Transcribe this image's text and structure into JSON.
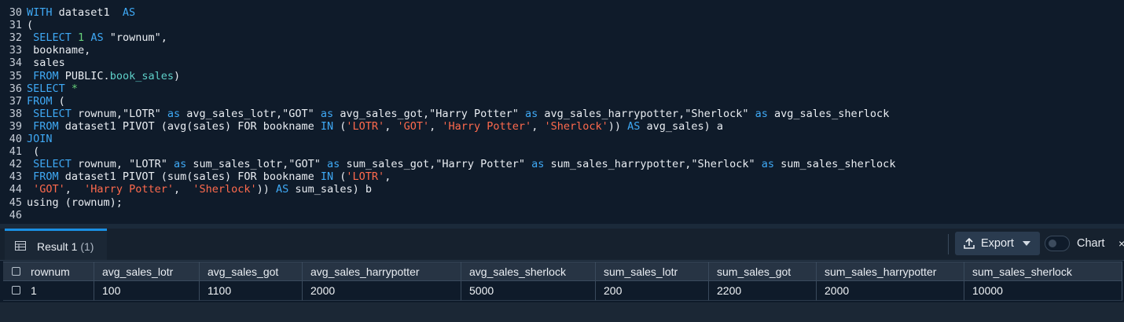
{
  "editor": {
    "lines": [
      {
        "n": "30",
        "t": [
          [
            "kw",
            "WITH"
          ],
          [
            "",
            "dataset1 "
          ],
          [
            "kw",
            "AS"
          ]
        ]
      },
      {
        "n": "31",
        "t": [
          [
            "",
            "("
          ]
        ]
      },
      {
        "n": "32",
        "t": [
          [
            "",
            ""
          ],
          [
            "kw",
            "SELECT"
          ],
          [
            "",
            ""
          ],
          [
            "num",
            "1"
          ],
          [
            "",
            ""
          ],
          [
            "kw",
            "AS"
          ],
          [
            "",
            "\"rownum\","
          ]
        ]
      },
      {
        "n": "33",
        "t": [
          [
            "",
            "bookname,"
          ]
        ]
      },
      {
        "n": "34",
        "t": [
          [
            "",
            "sales"
          ]
        ]
      },
      {
        "n": "35",
        "t": [
          [
            "kw",
            "FROM"
          ],
          [
            "",
            "PUBLIC."
          ],
          [
            "ident",
            "book_sales"
          ],
          [
            "",
            ")"
          ]
        ]
      },
      {
        "n": "36",
        "t": [
          [
            "kw",
            "SELECT"
          ],
          [
            "num",
            "*"
          ]
        ]
      },
      {
        "n": "37",
        "t": [
          [
            "kw",
            "FROM"
          ],
          [
            "",
            "("
          ]
        ]
      },
      {
        "n": "38",
        "t": [
          [
            "kw",
            "SELECT"
          ],
          [
            "",
            "rownum,\"LOTR\""
          ],
          [
            "kw",
            "as"
          ],
          [
            "",
            "avg_sales_lotr,\"GOT\""
          ],
          [
            "kw",
            "as"
          ],
          [
            "",
            "avg_sales_got,\"Harry Potter\""
          ],
          [
            "kw",
            "as"
          ],
          [
            "",
            "avg_sales_harrypotter,\"Sherlock\""
          ],
          [
            "kw",
            "as"
          ],
          [
            "",
            "avg_sales_sherlock"
          ]
        ]
      },
      {
        "n": "39",
        "t": [
          [
            "kw",
            "FROM"
          ],
          [
            "",
            "dataset1 PIVOT (avg(sales) FOR bookname"
          ],
          [
            "kw",
            "IN"
          ],
          [
            "",
            "("
          ],
          [
            "str",
            "'LOTR'"
          ],
          [
            "",
            ","
          ],
          [
            "str",
            "'GOT'"
          ],
          [
            "",
            ","
          ],
          [
            "str",
            "'Harry Potter'"
          ],
          [
            "",
            ","
          ],
          [
            "str",
            "'Sherlock'"
          ],
          [
            "",
            "))"
          ],
          [
            "kw",
            "AS"
          ],
          [
            "",
            "avg_sales) a"
          ]
        ]
      },
      {
        "n": "40",
        "t": [
          [
            "kw",
            "JOIN"
          ]
        ]
      },
      {
        "n": "41",
        "t": [
          [
            "",
            "("
          ]
        ]
      },
      {
        "n": "42",
        "t": [
          [
            "kw",
            "SELECT"
          ],
          [
            "",
            "rownum, \"LOTR\""
          ],
          [
            "kw",
            "as"
          ],
          [
            "",
            "sum_sales_lotr,\"GOT\""
          ],
          [
            "kw",
            "as"
          ],
          [
            "",
            "sum_sales_got,\"Harry Potter\""
          ],
          [
            "kw",
            "as"
          ],
          [
            "",
            "sum_sales_harrypotter,\"Sherlock\""
          ],
          [
            "kw",
            "as"
          ],
          [
            "",
            "sum_sales_sherlock"
          ]
        ]
      },
      {
        "n": "43",
        "t": [
          [
            "kw",
            "FROM"
          ],
          [
            "",
            "dataset1 PIVOT (sum(sales) FOR bookname"
          ],
          [
            "kw",
            "IN"
          ],
          [
            "",
            "("
          ],
          [
            "str",
            "'LOTR'"
          ],
          [
            "",
            ","
          ]
        ]
      },
      {
        "n": "44",
        "t": [
          [
            "str",
            "'GOT'"
          ],
          [
            "",
            ", "
          ],
          [
            "str",
            "'Harry Potter'"
          ],
          [
            "",
            ", "
          ],
          [
            "str",
            "'Sherlock'"
          ],
          [
            "",
            "))"
          ],
          [
            "kw",
            "AS"
          ],
          [
            "",
            "sum_sales) b"
          ]
        ]
      },
      {
        "n": "45",
        "t": [
          [
            "",
            "using (rownum);"
          ]
        ]
      },
      {
        "n": "46",
        "t": []
      }
    ]
  },
  "results": {
    "tab_label": "Result 1",
    "tab_count": "(1)",
    "export_label": "Export",
    "chart_label": "Chart",
    "close_glyph": "×",
    "columns": [
      "rownum",
      "avg_sales_lotr",
      "avg_sales_got",
      "avg_sales_harrypotter",
      "avg_sales_sherlock",
      "sum_sales_lotr",
      "sum_sales_got",
      "sum_sales_harrypotter",
      "sum_sales_sherlock"
    ],
    "rows": [
      [
        "1",
        "100",
        "1100",
        "2000",
        "5000",
        "200",
        "2200",
        "2000",
        "10000"
      ]
    ]
  },
  "colors": {
    "keyword": "#3fa9f5",
    "string": "#ff6a4d",
    "number": "#66d17a",
    "identifier": "#5ed0c9",
    "accent": "#1a8fe3"
  }
}
